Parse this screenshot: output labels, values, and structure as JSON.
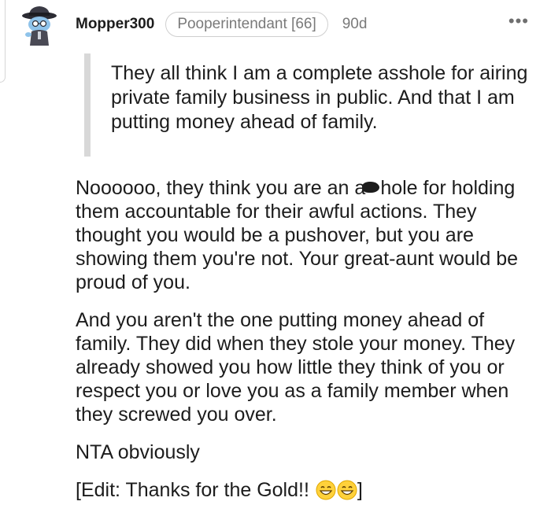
{
  "comment": {
    "username": "Mopper300",
    "flair": "Pooperintendant [66]",
    "age": "90d",
    "more_label": "•••",
    "quote": "They all think I am a complete asshole for airing private family business in public. And that I am putting money ahead of family.",
    "paragraph1_before": "Noooooo, they think you are an a",
    "paragraph1_after": "hole for holding them accountable for their awful actions. They thought you would be a pushover, but you are showing them you're not. Your great-aunt would be proud of you.",
    "paragraph2": "And you aren't the one putting money ahead of family. They did when they stole your money. They already showed you how little they think of you or respect you or love you as a family member when they screwed you over.",
    "paragraph3": "NTA obviously",
    "edit_text": "[Edit: Thanks for the Gold!! ",
    "edit_close": "]",
    "icons": {
      "avatar": "snoo-avatar-icon",
      "censor": "censor-scribble-icon",
      "emoji": "grinning-face-icon"
    }
  }
}
